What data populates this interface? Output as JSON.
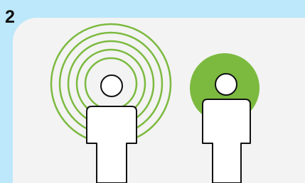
{
  "step_label": "2",
  "colors": {
    "outer_background": "#bde7fb",
    "panel_background": "#f3f3f3",
    "ring_stroke": "#7cba3f",
    "solid_circle_fill": "#7cba3f",
    "figure_fill": "#ffffff",
    "figure_outline": "#111111"
  },
  "left_figure": {
    "concentric_ring_count": 5
  },
  "right_figure": {
    "background_shape": "solid green circle"
  }
}
